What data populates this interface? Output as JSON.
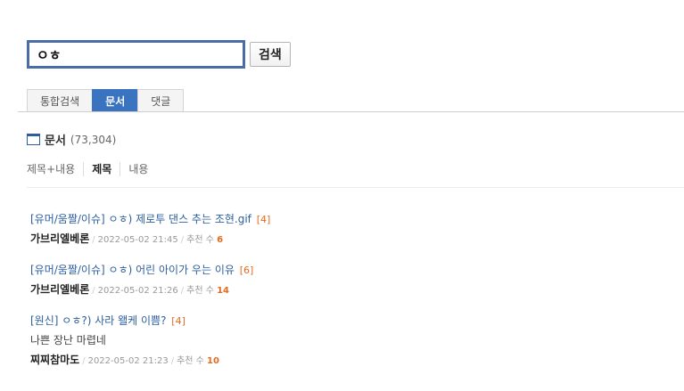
{
  "search": {
    "query": "ㅇㅎ",
    "button_label": "검색"
  },
  "tabs": [
    {
      "label": "통합검색",
      "active": false
    },
    {
      "label": "문서",
      "active": true
    },
    {
      "label": "댓글",
      "active": false
    }
  ],
  "section": {
    "label": "문서",
    "count": "(73,304)"
  },
  "filters": [
    {
      "label": "제목+내용",
      "active": false
    },
    {
      "label": "제목",
      "active": true
    },
    {
      "label": "내용",
      "active": false
    }
  ],
  "results": [
    {
      "category": "[유머/움짤/이슈]",
      "title": "ㅇㅎ) 제로투 댄스 추는 조현.gif",
      "comments": "[4]",
      "snippet": "",
      "author": "가브리엘베론",
      "datetime": "2022-05-02 21:45",
      "rec_label": "추천 수",
      "rec_count": "6"
    },
    {
      "category": "[유머/움짤/이슈]",
      "title": "ㅇㅎ) 어린 아이가 우는 이유",
      "comments": "[6]",
      "snippet": "",
      "author": "가브리엘베론",
      "datetime": "2022-05-02 21:26",
      "rec_label": "추천 수",
      "rec_count": "14"
    },
    {
      "category": "[원신]",
      "title": "ㅇㅎ?) 사라 왤케 이쁨?",
      "comments": "[4]",
      "snippet": "나쁜 장난 마렵네",
      "author": "찌찌참마도",
      "datetime": "2022-05-02 21:23",
      "rec_label": "추천 수",
      "rec_count": "10"
    }
  ],
  "colors": {
    "accent": "#3a73c0",
    "link": "#2c5f9e",
    "count": "#e36b1e",
    "input_border": "#4a6da7"
  }
}
